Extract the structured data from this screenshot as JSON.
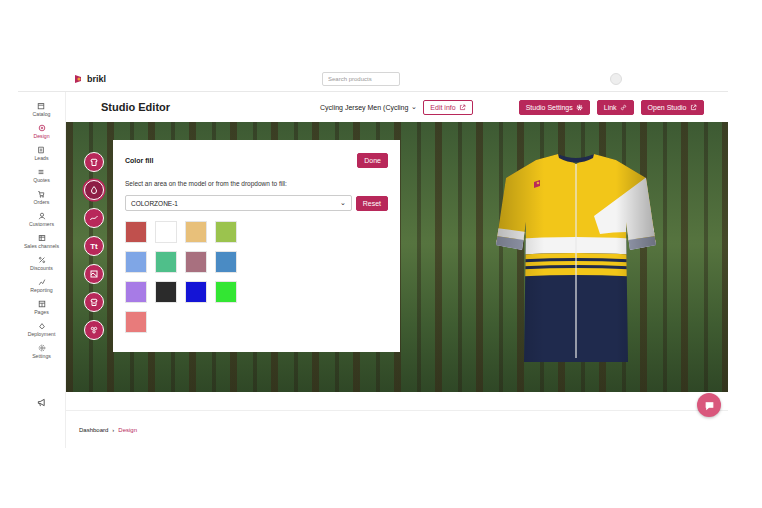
{
  "brand": {
    "name": "brikl"
  },
  "search": {
    "placeholder": "Search products"
  },
  "sidebar": {
    "items": [
      {
        "label": "Catalog",
        "selected": false
      },
      {
        "label": "Design",
        "selected": true
      },
      {
        "label": "Leads",
        "selected": false
      },
      {
        "label": "Quotes",
        "selected": false
      },
      {
        "label": "Orders",
        "selected": false
      },
      {
        "label": "Customers",
        "selected": false
      },
      {
        "label": "Sales channels",
        "selected": false
      },
      {
        "label": "Discounts",
        "selected": false
      },
      {
        "label": "Reporting",
        "selected": false
      },
      {
        "label": "Pages",
        "selected": false
      },
      {
        "label": "Deployment",
        "selected": false
      },
      {
        "label": "Settings",
        "selected": false
      }
    ]
  },
  "header": {
    "title": "Studio Editor",
    "product": "Cycling Jersey Men (Cycling",
    "product_caret": "⌄",
    "buttons": [
      {
        "label": "Edit info",
        "kind": "outline"
      },
      {
        "label": "Studio Settings",
        "kind": "fill"
      },
      {
        "label": "Link",
        "kind": "fill"
      },
      {
        "label": "Open Studio",
        "kind": "fill"
      }
    ]
  },
  "tools": [
    {
      "label": "",
      "selected": false
    },
    {
      "label": "",
      "selected": true
    },
    {
      "label": "",
      "selected": false
    },
    {
      "label": "Tt",
      "selected": false
    },
    {
      "label": "",
      "selected": false
    },
    {
      "label": "",
      "selected": false
    },
    {
      "label": "",
      "selected": false
    }
  ],
  "color_fill": {
    "title": "Color fill",
    "done": "Done",
    "instruction": "Select an area on the model or from the dropdown to fill:",
    "zone": "COLORZONE-1",
    "zone_caret": "⌄",
    "reset": "Reset",
    "swatches": [
      {
        "color": "#c0504d"
      },
      {
        "color": "#ffffff"
      },
      {
        "color": "#e8c07a"
      },
      {
        "color": "#9bc34e"
      },
      {
        "color": "#7fa6e6"
      },
      {
        "color": "#4fbf8a"
      },
      {
        "color": "#a8707f"
      },
      {
        "color": "#4a8bc4"
      },
      {
        "color": "#a77be6"
      },
      {
        "color": "#2b2b2b"
      },
      {
        "color": "#1414d6"
      },
      {
        "color": "#33e633"
      },
      {
        "color": "#e87b7b"
      }
    ]
  },
  "breadcrumb": {
    "items": [
      {
        "label": "Dashboard",
        "selected": false
      },
      {
        "label": "Design",
        "selected": true
      }
    ],
    "separator": "›"
  }
}
